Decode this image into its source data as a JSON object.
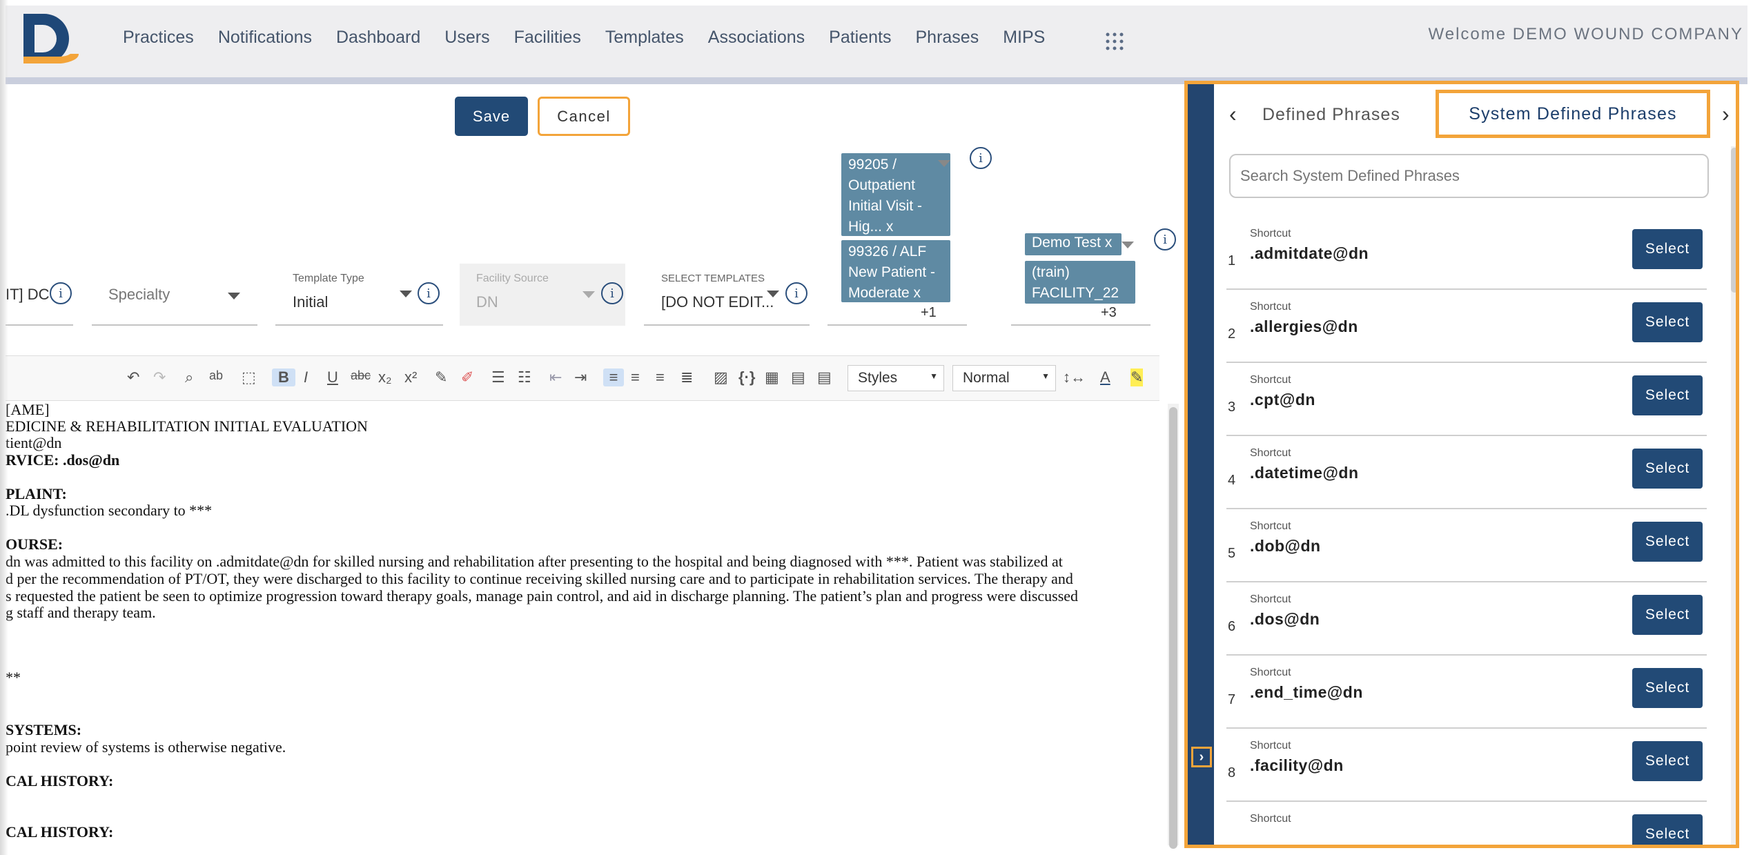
{
  "nav": {
    "items": [
      "Practices",
      "Notifications",
      "Dashboard",
      "Users",
      "Facilities",
      "Templates",
      "Associations",
      "Patients",
      "Phrases",
      "MIPS"
    ],
    "welcome": "Welcome DEMO WOUND COMPANY"
  },
  "actions": {
    "save": "Save",
    "cancel": "Cancel"
  },
  "form": {
    "truncated_value": "IT] DC",
    "specialty_placeholder": "Specialty",
    "template_type": {
      "label": "Template Type",
      "value": "Initial"
    },
    "facility_source": {
      "label": "Facility Source",
      "value": "DN"
    },
    "select_templates": {
      "label": "SELECT TEMPLATES",
      "value": "[DO NOT EDIT..."
    },
    "cpt_chips": [
      "99205 / Outpatient Initial Visit - Hig...  x",
      "99326 / ALF New Patient - Moderate  x"
    ],
    "cpt_more": "+1",
    "facility_chips": [
      "Demo Test  x",
      "(train) FACILITY_22  x"
    ],
    "facility_more": "+3"
  },
  "toolbar": {
    "styles": "Styles",
    "format": "Normal",
    "icons": [
      "undo-icon",
      "redo-icon",
      "find-icon",
      "spellcheck-icon",
      "bold-icon",
      "italic-icon",
      "underline-icon",
      "strike-icon",
      "subscript-icon",
      "superscript-icon",
      "copy-format-icon",
      "remove-format-icon",
      "numbered-list-icon",
      "bulleted-list-icon",
      "outdent-icon",
      "indent-icon",
      "align-left-icon",
      "align-center-icon",
      "align-right-icon",
      "justify-icon",
      "image-icon",
      "code-icon",
      "table-icon"
    ]
  },
  "editor": {
    "lines": [
      "[AME]",
      "EDICINE & REHABILITATION INITIAL EVALUATION",
      "tient@dn",
      "RVICE: .dos@dn",
      "PLAINT:",
      ".DL dysfunction secondary to ***",
      "OURSE:",
      "dn was admitted to this facility on .admitdate@dn for skilled nursing and rehabilitation after presenting to the hospital and being diagnosed with ***. Patient was stabilized at",
      "d per the recommendation of PT/OT, they were discharged to this facility to continue receiving skilled nursing care and to participate in rehabilitation services.  The therapy and",
      "s requested the patient be seen to optimize progression toward therapy goals, manage pain control, and aid in discharge planning. The patient’s plan and progress were discussed",
      "g staff and therapy team.",
      "**",
      "SYSTEMS:",
      "point review of systems is otherwise negative.",
      "CAL HISTORY:",
      "CAL HISTORY:"
    ]
  },
  "panel": {
    "tab_defined": "Defined Phrases",
    "tab_system": "System Defined Phrases",
    "search_placeholder": "Search System Defined Phrases",
    "shortcut_label": "Shortcut",
    "select_label": "Select",
    "phrases": [
      {
        "num": "1",
        "code": ".admitdate@dn"
      },
      {
        "num": "2",
        "code": ".allergies@dn"
      },
      {
        "num": "3",
        "code": ".cpt@dn"
      },
      {
        "num": "4",
        "code": ".datetime@dn"
      },
      {
        "num": "5",
        "code": ".dob@dn"
      },
      {
        "num": "6",
        "code": ".dos@dn"
      },
      {
        "num": "7",
        "code": ".end_time@dn"
      },
      {
        "num": "8",
        "code": ".facility@dn"
      },
      {
        "num": "",
        "code": ""
      }
    ]
  },
  "colors": {
    "brand": "#224a76",
    "accent": "#f3a43a",
    "chip": "#5f8aa3"
  }
}
